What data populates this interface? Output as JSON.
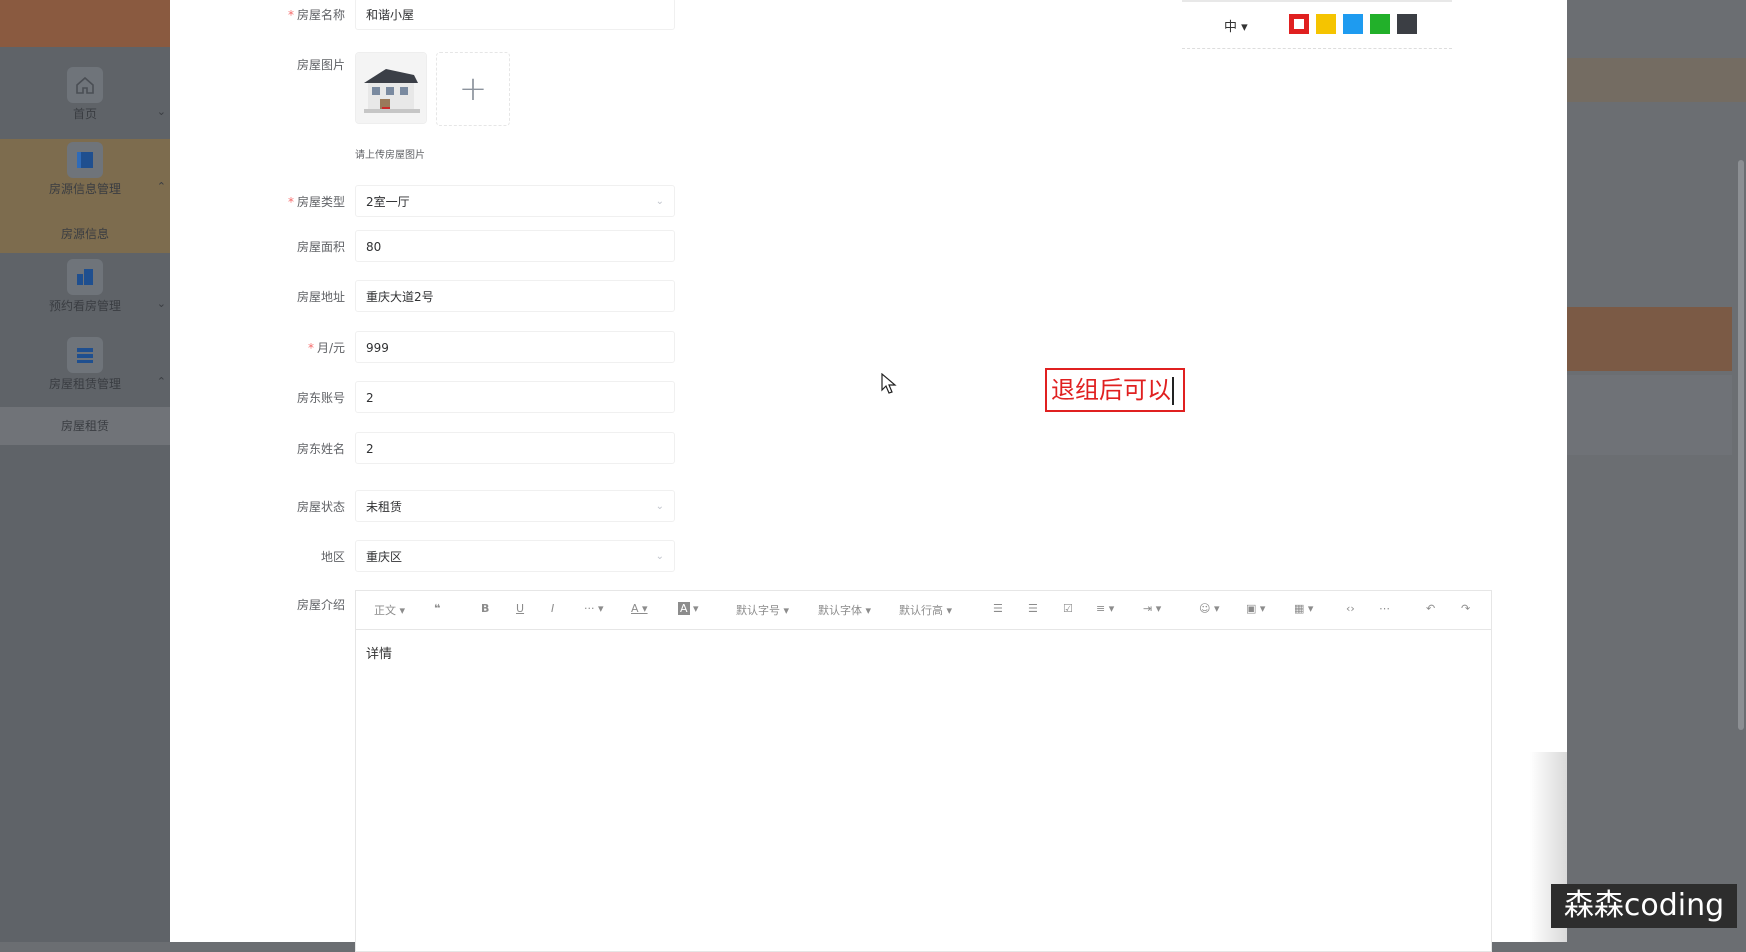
{
  "sidebar": {
    "items": [
      {
        "label": "首页",
        "icon": "home-icon"
      },
      {
        "label": "房源信息管理",
        "icon": "panel-icon"
      },
      {
        "label": "预约看房管理",
        "icon": "building-icon"
      },
      {
        "label": "房屋租赁管理",
        "icon": "list-icon"
      }
    ],
    "subitems": [
      {
        "label": "房源信息"
      },
      {
        "label": "房屋租赁"
      }
    ]
  },
  "form": {
    "name_label": "房屋名称",
    "name_value": "和谐小屋",
    "image_label": "房屋图片",
    "image_hint": "请上传房屋图片",
    "type_label": "房屋类型",
    "type_value": "2室一厅",
    "area_label": "房屋面积",
    "area_value": "80",
    "address_label": "房屋地址",
    "address_value": "重庆大道2号",
    "rent_label": "月/元",
    "rent_value": "999",
    "landlord_account_label": "房东账号",
    "landlord_account_value": "2",
    "landlord_name_label": "房东姓名",
    "landlord_name_value": "2",
    "status_label": "房屋状态",
    "status_value": "未租赁",
    "region_label": "地区",
    "region_value": "重庆区",
    "intro_label": "房屋介绍",
    "required_mark": "*"
  },
  "editor": {
    "toolbar": {
      "heading": "正文",
      "quote": "❝",
      "bold": "B",
      "underline": "U",
      "italic": "I",
      "more": "···",
      "font_color": "A",
      "bg_color": "A",
      "font_size": "默认字号",
      "font_family": "默认字体",
      "line_height": "默认行高"
    },
    "content": "详情"
  },
  "annotation": {
    "size": "中",
    "colors": [
      "#e02020",
      "#f5c400",
      "#1e9bf0",
      "#22b02a",
      "#3b3e44"
    ],
    "text": "退组后可以"
  },
  "watermark": "森森coding"
}
